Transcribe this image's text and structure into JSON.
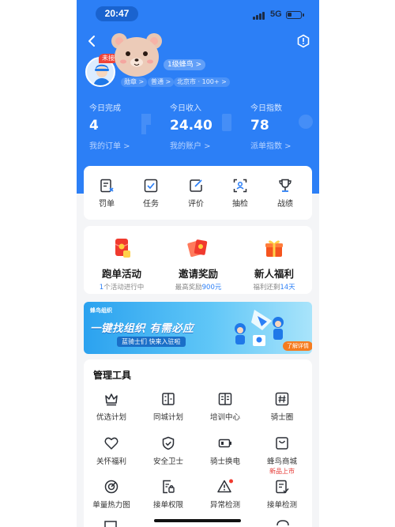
{
  "status_bar": {
    "time": "20:47",
    "network": "5G",
    "battery_level": 0.3
  },
  "header": {
    "avatar_badge": "未接",
    "level_badge": "1级蜂鸟 >",
    "tags": [
      "勋章 >",
      "普通 >",
      "北京市 · 100+ >"
    ]
  },
  "stats": [
    {
      "label": "今日完成",
      "value": "4",
      "link": "我的订单 >"
    },
    {
      "label": "今日收入",
      "value": "24.40",
      "link": "我的账户 >"
    },
    {
      "label": "今日指数",
      "value": "78",
      "link": "派单指数 >"
    }
  ],
  "quick_actions": [
    {
      "label": "罚单",
      "icon": "ticket-icon"
    },
    {
      "label": "任务",
      "icon": "task-icon"
    },
    {
      "label": "评价",
      "icon": "review-icon"
    },
    {
      "label": "抽检",
      "icon": "scan-icon"
    },
    {
      "label": "战绩",
      "icon": "trophy-icon"
    }
  ],
  "promos": [
    {
      "title": "跑单活动",
      "sub_pre": "",
      "sub_highlight": "1",
      "sub_post": "个活动进行中",
      "icon": "red-packet-icon"
    },
    {
      "title": "邀请奖励",
      "sub_pre": "最高奖励",
      "sub_highlight": "900元",
      "sub_post": "",
      "icon": "cards-icon"
    },
    {
      "title": "新人福利",
      "sub_pre": "福利还剩",
      "sub_highlight": "14天",
      "sub_post": "",
      "icon": "gift-icon"
    }
  ],
  "banner": {
    "logo": "蜂鸟组织",
    "headline": "一键找组织 有需必应",
    "subline": "蓝骑士们 快来入驻啦",
    "button": "了解详情"
  },
  "tools": {
    "title": "管理工具",
    "items": [
      {
        "label": "优选计划",
        "icon": "crown-icon",
        "sub": ""
      },
      {
        "label": "同城计划",
        "icon": "building-icon",
        "sub": ""
      },
      {
        "label": "培训中心",
        "icon": "book-icon",
        "sub": ""
      },
      {
        "label": "骑士圈",
        "icon": "hash-icon",
        "sub": ""
      },
      {
        "label": "关怀福利",
        "icon": "heart-icon",
        "sub": ""
      },
      {
        "label": "安全卫士",
        "icon": "shield-icon",
        "sub": ""
      },
      {
        "label": "骑士换电",
        "icon": "battery-swap-icon",
        "sub": ""
      },
      {
        "label": "蜂鸟商城",
        "icon": "shop-icon",
        "sub": "新品上市"
      },
      {
        "label": "单量热力图",
        "icon": "target-icon",
        "sub": ""
      },
      {
        "label": "接单权限",
        "icon": "permission-icon",
        "sub": ""
      },
      {
        "label": "异常检测",
        "icon": "warning-icon",
        "sub": ""
      },
      {
        "label": "接单检测",
        "icon": "check-doc-icon",
        "sub": ""
      }
    ]
  }
}
